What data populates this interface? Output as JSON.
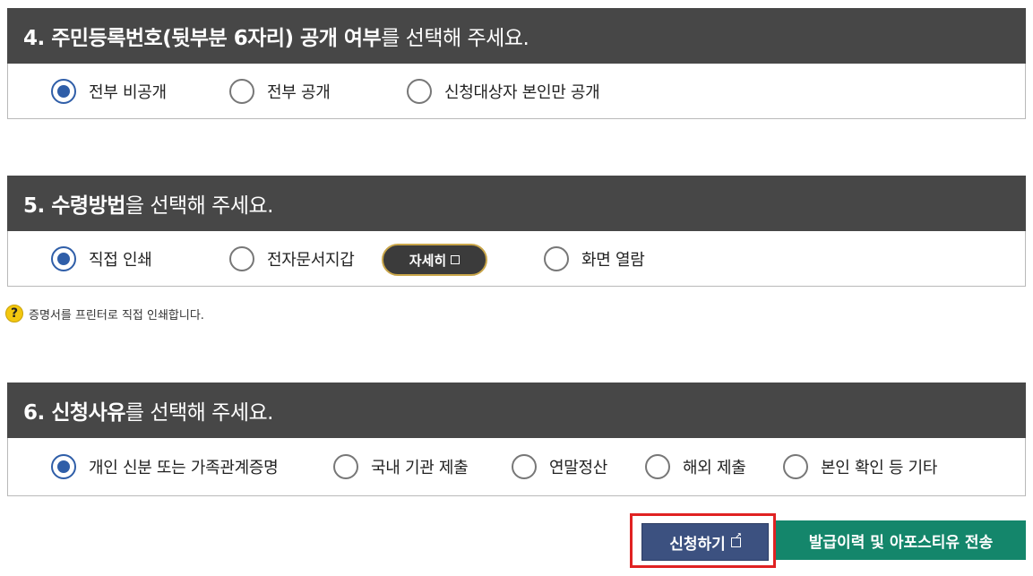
{
  "section4": {
    "title_bold": "4. 주민등록번호(뒷부분 6자리) 공개 여부",
    "title_rest": "를 선택해 주세요.",
    "options": [
      {
        "label": "전부 비공개",
        "checked": true
      },
      {
        "label": "전부 공개",
        "checked": false
      },
      {
        "label": "신청대상자 본인만 공개",
        "checked": false
      }
    ]
  },
  "section5": {
    "title_bold": "5. 수령방법",
    "title_rest": "을 선택해 주세요.",
    "options": [
      {
        "label": "직접 인쇄",
        "checked": true
      },
      {
        "label": "전자문서지갑",
        "checked": false
      },
      {
        "label": "화면 열람",
        "checked": false
      }
    ],
    "detail_button": "자세히",
    "help_text": "증명서를 프린터로 직접 인쇄합니다."
  },
  "section6": {
    "title_bold": "6. 신청사유",
    "title_rest": "를 선택해 주세요.",
    "options": [
      {
        "label": "개인 신분 또는 가족관계증명",
        "checked": true
      },
      {
        "label": "국내 기관 제출",
        "checked": false
      },
      {
        "label": "연말정산",
        "checked": false
      },
      {
        "label": "해외 제출",
        "checked": false
      },
      {
        "label": "본인 확인 등 기타",
        "checked": false
      }
    ]
  },
  "actions": {
    "submit_label": "신청하기",
    "history_label": "발급이력 및 아포스티유 전송"
  },
  "colors": {
    "header_bg": "#474747",
    "radio_checked": "#2f5ea8",
    "submit_bg": "#3c5180",
    "history_bg": "#14866b",
    "highlight_border": "#e02222"
  }
}
